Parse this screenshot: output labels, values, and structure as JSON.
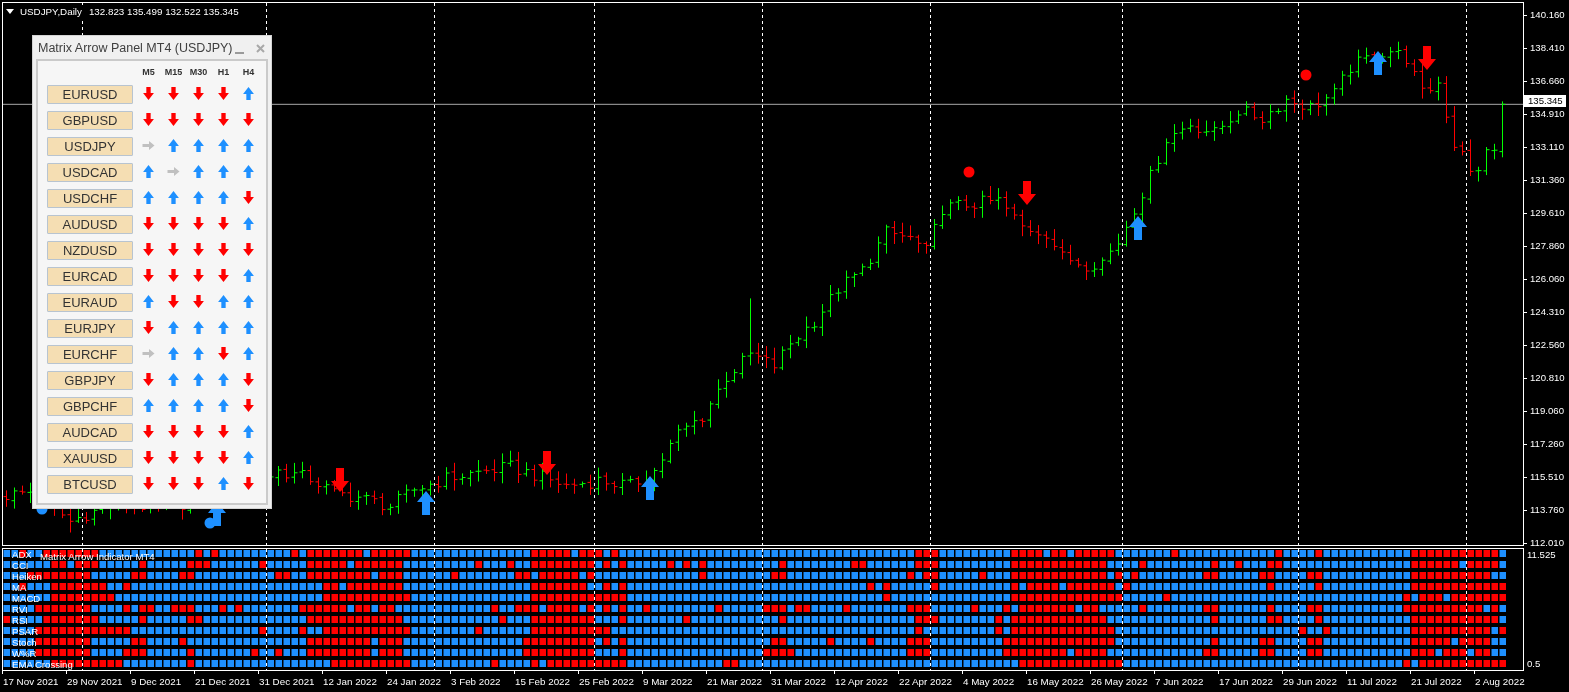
{
  "chart": {
    "symbol_label": "USDJPY,Daily",
    "ohlc": "132.823 135.499 132.522 135.345",
    "price_axis": [
      "140.160",
      "138.410",
      "136.660",
      "134.910",
      "133.110",
      "131.360",
      "129.610",
      "127.860",
      "126.060",
      "124.310",
      "122.560",
      "120.810",
      "119.060",
      "117.260",
      "115.510",
      "113.760",
      "112.010"
    ],
    "current_price": "135.345"
  },
  "panel": {
    "title": "Matrix Arrow Panel MT4 (USDJPY)",
    "columns": [
      "M5",
      "M15",
      "M30",
      "H1",
      "H4"
    ],
    "rows": [
      {
        "symbol": "EURUSD",
        "signals": [
          {
            "kind": "down"
          },
          {
            "kind": "down"
          },
          {
            "kind": "down"
          },
          {
            "kind": "down"
          },
          {
            "kind": "up"
          }
        ]
      },
      {
        "symbol": "GBPUSD",
        "signals": [
          {
            "kind": "down"
          },
          {
            "kind": "down"
          },
          {
            "kind": "down"
          },
          {
            "kind": "down"
          },
          {
            "kind": "down"
          }
        ]
      },
      {
        "symbol": "USDJPY",
        "signals": [
          {
            "kind": "flat"
          },
          {
            "kind": "up"
          },
          {
            "kind": "up"
          },
          {
            "kind": "up"
          },
          {
            "kind": "up"
          }
        ]
      },
      {
        "symbol": "USDCAD",
        "signals": [
          {
            "kind": "up"
          },
          {
            "kind": "flat"
          },
          {
            "kind": "up"
          },
          {
            "kind": "up"
          },
          {
            "kind": "up"
          }
        ]
      },
      {
        "symbol": "USDCHF",
        "signals": [
          {
            "kind": "up"
          },
          {
            "kind": "up"
          },
          {
            "kind": "up"
          },
          {
            "kind": "up"
          },
          {
            "kind": "down"
          }
        ]
      },
      {
        "symbol": "AUDUSD",
        "signals": [
          {
            "kind": "down"
          },
          {
            "kind": "down"
          },
          {
            "kind": "down"
          },
          {
            "kind": "down"
          },
          {
            "kind": "up"
          }
        ]
      },
      {
        "symbol": "NZDUSD",
        "signals": [
          {
            "kind": "down"
          },
          {
            "kind": "down"
          },
          {
            "kind": "down"
          },
          {
            "kind": "down"
          },
          {
            "kind": "down"
          }
        ]
      },
      {
        "symbol": "EURCAD",
        "signals": [
          {
            "kind": "down"
          },
          {
            "kind": "down"
          },
          {
            "kind": "down"
          },
          {
            "kind": "down"
          },
          {
            "kind": "up"
          }
        ]
      },
      {
        "symbol": "EURAUD",
        "signals": [
          {
            "kind": "up"
          },
          {
            "kind": "down"
          },
          {
            "kind": "down"
          },
          {
            "kind": "up"
          },
          {
            "kind": "up"
          }
        ]
      },
      {
        "symbol": "EURJPY",
        "signals": [
          {
            "kind": "down"
          },
          {
            "kind": "up"
          },
          {
            "kind": "up"
          },
          {
            "kind": "up"
          },
          {
            "kind": "up"
          }
        ]
      },
      {
        "symbol": "EURCHF",
        "signals": [
          {
            "kind": "flat"
          },
          {
            "kind": "up"
          },
          {
            "kind": "up"
          },
          {
            "kind": "down"
          },
          {
            "kind": "up"
          }
        ]
      },
      {
        "symbol": "GBPJPY",
        "signals": [
          {
            "kind": "down"
          },
          {
            "kind": "up"
          },
          {
            "kind": "up"
          },
          {
            "kind": "up"
          },
          {
            "kind": "down"
          }
        ]
      },
      {
        "symbol": "GBPCHF",
        "signals": [
          {
            "kind": "up"
          },
          {
            "kind": "up"
          },
          {
            "kind": "up"
          },
          {
            "kind": "up"
          },
          {
            "kind": "down"
          }
        ]
      },
      {
        "symbol": "AUDCAD",
        "signals": [
          {
            "kind": "down"
          },
          {
            "kind": "down"
          },
          {
            "kind": "down"
          },
          {
            "kind": "down"
          },
          {
            "kind": "up"
          }
        ]
      },
      {
        "symbol": "XAUUSD",
        "signals": [
          {
            "kind": "down"
          },
          {
            "kind": "down"
          },
          {
            "kind": "down"
          },
          {
            "kind": "down"
          },
          {
            "kind": "up"
          }
        ]
      },
      {
        "symbol": "BTCUSD",
        "signals": [
          {
            "kind": "down"
          },
          {
            "kind": "down"
          },
          {
            "kind": "down"
          },
          {
            "kind": "up"
          },
          {
            "kind": "down"
          }
        ]
      }
    ]
  },
  "indicator": {
    "title": "Matrix Arrow Indicator MT4",
    "rows": [
      "ADX",
      "CCI",
      "Heiken",
      "MA",
      "MACD",
      "RVI",
      "RSI",
      "PSAR",
      "Stoch",
      "W%R",
      "EMA Crossing"
    ],
    "axis": [
      "11.525",
      "0.5"
    ]
  },
  "time_axis": [
    "17 Nov 2021",
    "29 Nov 2021",
    "9 Dec 2021",
    "21 Dec 2021",
    "31 Dec 2021",
    "12 Jan 2022",
    "24 Jan 2022",
    "3 Feb 2022",
    "15 Feb 2022",
    "25 Feb 2022",
    "9 Mar 2022",
    "21 Mar 2022",
    "31 Mar 2022",
    "12 Apr 2022",
    "22 Apr 2022",
    "4 May 2022",
    "16 May 2022",
    "26 May 2022",
    "7 Jun 2022",
    "17 Jun 2022",
    "29 Jun 2022",
    "11 Jul 2022",
    "21 Jul 2022",
    "2 Aug 2022"
  ]
}
